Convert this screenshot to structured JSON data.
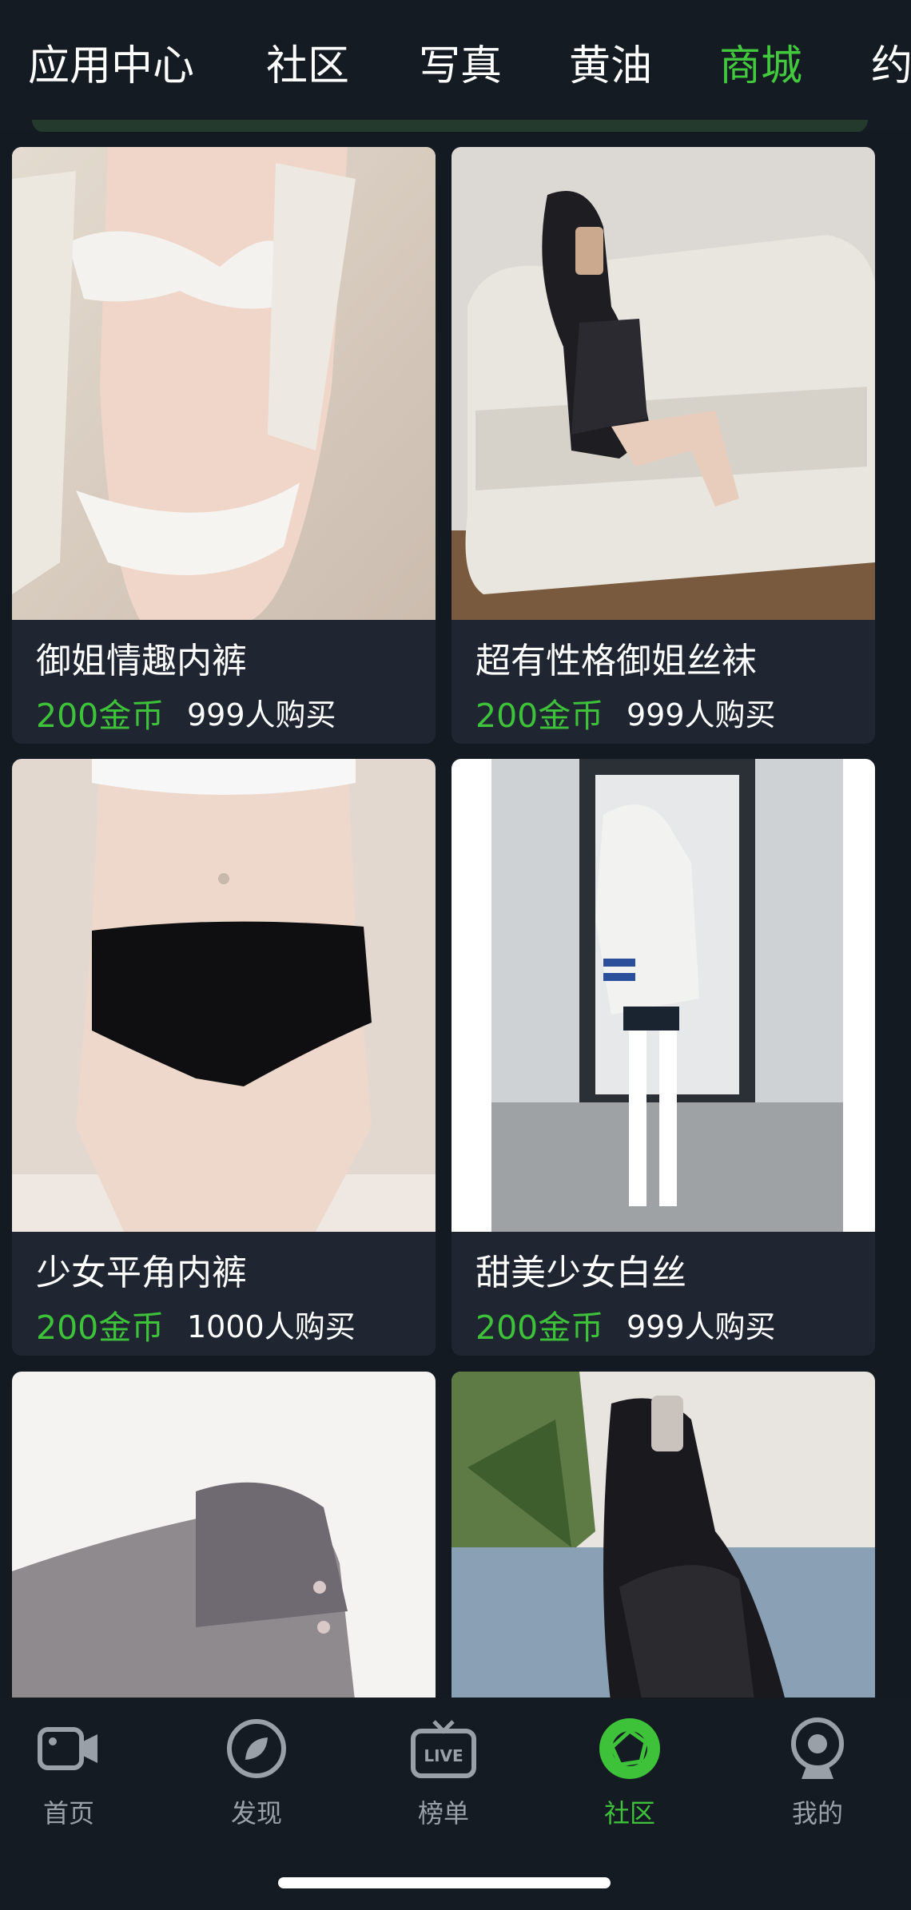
{
  "top_tabs": [
    {
      "label": "应用中心",
      "active": false
    },
    {
      "label": "社区",
      "active": false
    },
    {
      "label": "写真",
      "active": false
    },
    {
      "label": "黄油",
      "active": false
    },
    {
      "label": "商城",
      "active": true
    },
    {
      "label": "约",
      "active": false
    }
  ],
  "products": [
    {
      "title": "御姐情趣内裤",
      "price": "200金币",
      "buyers": "999人购买"
    },
    {
      "title": "超有性格御姐丝袜",
      "price": "200金币",
      "buyers": "999人购买"
    },
    {
      "title": "少女平角内裤",
      "price": "200金币",
      "buyers": "1000人购买"
    },
    {
      "title": "甜美少女白丝",
      "price": "200金币",
      "buyers": "999人购买"
    },
    {
      "title": "",
      "price": "",
      "buyers": ""
    },
    {
      "title": "",
      "price": "",
      "buyers": ""
    }
  ],
  "bottom_nav": [
    {
      "label": "首页",
      "icon": "video-camera-icon",
      "active": false
    },
    {
      "label": "发现",
      "icon": "compass-icon",
      "active": false
    },
    {
      "label": "榜单",
      "icon": "live-tv-icon",
      "active": false
    },
    {
      "label": "社区",
      "icon": "aperture-icon",
      "active": true
    },
    {
      "label": "我的",
      "icon": "webcam-icon",
      "active": false
    }
  ],
  "colors": {
    "accent": "#3ec23a",
    "background": "#141a22",
    "card": "#1f2632"
  }
}
